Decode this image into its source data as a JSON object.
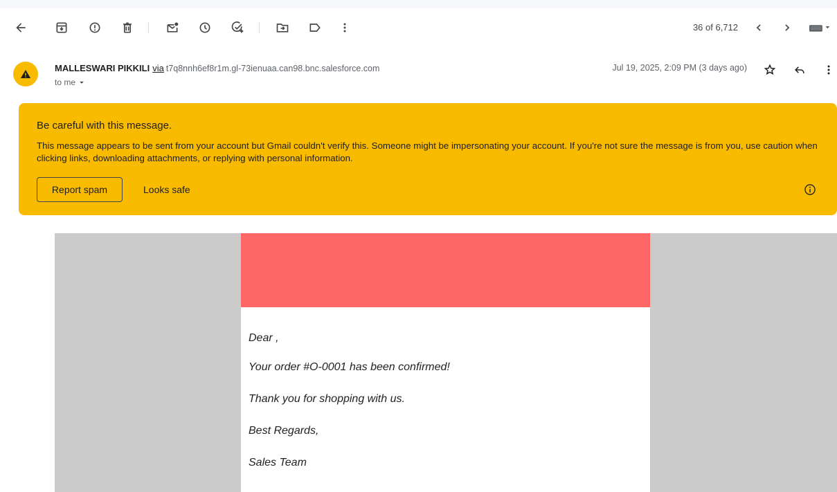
{
  "toolbar": {
    "counter": "36 of 6,712",
    "icons": [
      "back-arrow-icon",
      "archive-icon",
      "report-spam-icon",
      "delete-icon",
      "mark-unread-icon",
      "snooze-icon",
      "add-task-icon",
      "move-to-icon",
      "label-icon",
      "more-vertical-icon",
      "prev-icon",
      "next-icon",
      "keyboard-icon"
    ]
  },
  "message": {
    "sender_name": "MALLESWARI PIKKILI",
    "via_label": "via",
    "sender_domain": "t7q8nnh6ef8r1m.gl-73ienuaa.can98.bnc.salesforce.com",
    "to_label": "to me",
    "date": "Jul 19, 2025, 2:09 PM (3 days ago)"
  },
  "warning": {
    "title": "Be careful with this message.",
    "body": "This message appears to be sent from your account but Gmail couldn't verify this. Someone might be impersonating your account. If you're not sure the message is from you, use caution when clicking links, downloading attachments, or replying with personal information.",
    "report_spam": "Report spam",
    "looks_safe": "Looks safe"
  },
  "email": {
    "greeting": "Dear ,",
    "line1": "Your order #O-0001 has been confirmed!",
    "line2": "Thank you for shopping with us.",
    "closing": "Best Regards,",
    "signature": "Sales Team"
  },
  "colors": {
    "warning_bg": "#f9bb00",
    "banner": "#ff6666",
    "body_bg": "#cbcbcb"
  }
}
